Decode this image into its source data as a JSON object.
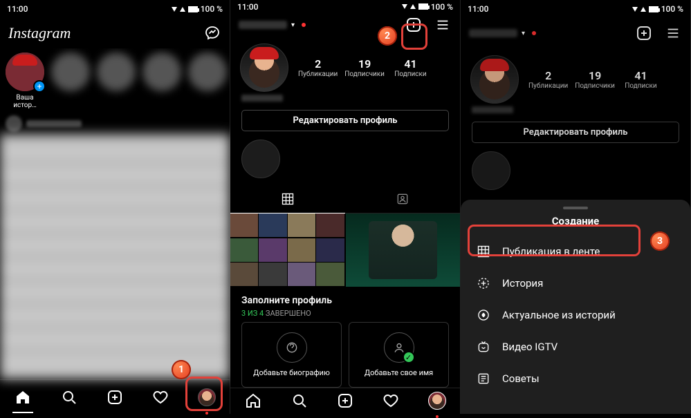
{
  "status": {
    "time": "11:00",
    "battery": "100 %"
  },
  "panel1": {
    "brand": "Instagram",
    "story_label": "Ваша истор…"
  },
  "panel2": {
    "stats": {
      "posts": "2",
      "posts_label": "Публикации",
      "followers": "19",
      "followers_label": "Подписчики",
      "following": "41",
      "following_label": "Подписки"
    },
    "edit_btn": "Редактировать профиль",
    "complete_title": "Заполните профиль",
    "complete_done": "3 ИЗ 4",
    "complete_suffix": " ЗАВЕРШЕНО",
    "card_bio": "Добавьте биографию",
    "card_name": "Добавьте свое имя"
  },
  "panel3": {
    "stats": {
      "posts": "2",
      "posts_label": "Публикации",
      "followers": "19",
      "followers_label": "Подписчики",
      "following": "41",
      "following_label": "Подписки"
    },
    "edit_btn": "Редактировать профиль",
    "sheet_title": "Создание",
    "sheet_items": {
      "feed": "Публикация в ленте",
      "story": "История",
      "highlight": "Актуальное из историй",
      "igtv": "Видео IGTV",
      "guide": "Советы"
    }
  },
  "callouts": {
    "one": "1",
    "two": "2",
    "three": "3"
  }
}
